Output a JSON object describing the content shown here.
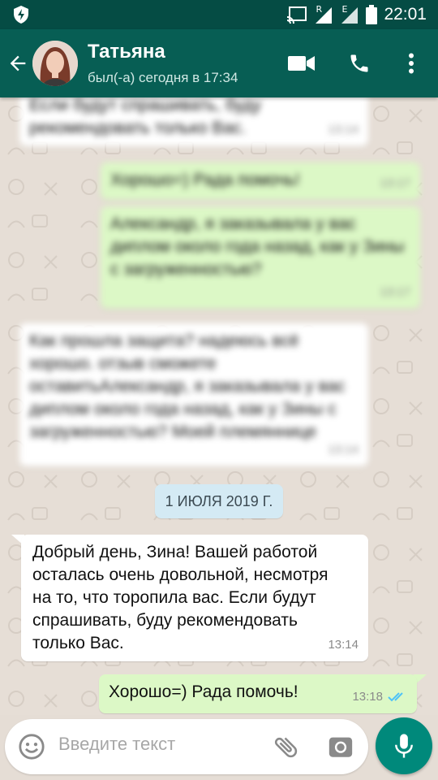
{
  "status_bar": {
    "time": "22:01",
    "icons": [
      "shield-icon",
      "cast-icon",
      "signal-r-icon",
      "signal-e-icon",
      "battery-icon"
    ],
    "roaming_label": "R",
    "network_label": "E"
  },
  "header": {
    "contact_name": "Татьяна",
    "last_seen": "был(-а) сегодня в 17:34",
    "icons": [
      "back-arrow-icon",
      "video-call-icon",
      "phone-icon",
      "more-vert-icon"
    ]
  },
  "blurred_messages": [
    {
      "direction": "in",
      "text": "Если будут спрашивать, буду рекомендовать только Вас.",
      "time": "13:14"
    },
    {
      "direction": "out",
      "text": "Хорошо=) Рада помочь!",
      "time": "13:17"
    },
    {
      "direction": "out",
      "text": "Александр, я заказывала у вас диплом около года назад, как у Зины с загруженностью?",
      "time": "13:17"
    },
    {
      "direction": "in",
      "text": "Как прошла защита? надеюсь всё хорошо. отзыв сможете оставитьАлександр, я заказывала у вас диплом около года назад, как у Зины с загруженностью? Моей племяннице",
      "time": "13:14"
    }
  ],
  "date_separator": "1 ИЮЛЯ 2019 Г.",
  "messages": [
    {
      "direction": "in",
      "text": "Добрый день, Зина! Вашей работой осталась очень довольной, несмотря на то, что торопила вас. Если будут спрашивать, буду рекомендовать только Вас.",
      "time": "13:14"
    },
    {
      "direction": "out",
      "text": "Хорошо=) Рада помочь!",
      "time": "13:18",
      "status": "read"
    }
  ],
  "input": {
    "placeholder": "Введите текст",
    "icons": [
      "emoji-icon",
      "attach-icon",
      "camera-icon",
      "mic-icon"
    ]
  },
  "colors": {
    "header": "#075e54",
    "status_bar": "#054c44",
    "incoming_bubble": "#ffffff",
    "outgoing_bubble": "#dcf8c6",
    "mic_button": "#00897b",
    "read_ticks": "#4fc3f7"
  }
}
